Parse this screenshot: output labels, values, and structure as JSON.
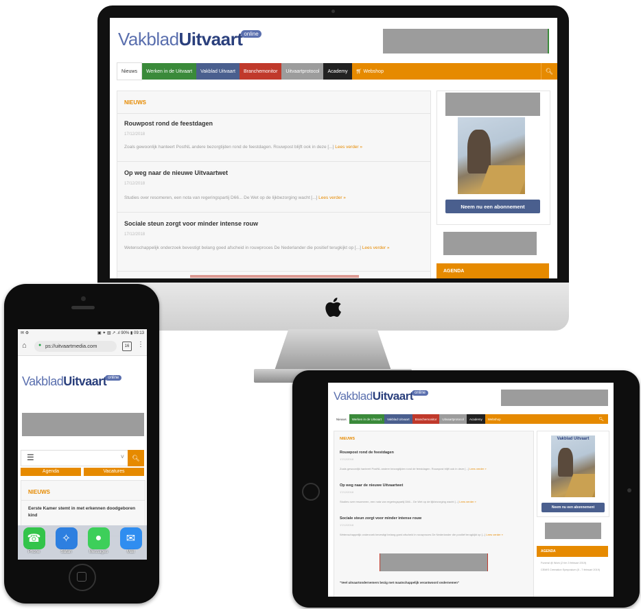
{
  "site": {
    "logo_light": "Vakblad",
    "logo_bold": "Uitvaart",
    "logo_badge": "online"
  },
  "nav": {
    "items": [
      "Nieuws",
      "Werken in de Uitvaart",
      "Vakblad Uitvaart",
      "Branchemonitor",
      "Uitvaartprotocol",
      "Academy",
      "Webshop"
    ],
    "colors": [
      "#ffffff",
      "#3a8a3a",
      "#4a5f8e",
      "#c0392b",
      "#9c9c9c",
      "#222222",
      "#e68a00"
    ]
  },
  "news": {
    "section_title": "NIEUWS",
    "posts": [
      {
        "title": "Rouwpost rond de feestdagen",
        "date": "17/12/2018",
        "excerpt": "Zoals gewoonlijk hanteert PostNL andere bezorgtijden rond de feestdagen. Rouwpost blijft ook in deze [...]",
        "more": "Lees verder »"
      },
      {
        "title": "Op weg naar de nieuwe Uitvaartwet",
        "date": "17/12/2018",
        "excerpt": "Studies over resomeren, een nota van regeringspartij D66... De Wet op de lijkbezorging wacht [...]",
        "more": "Lees verder »"
      },
      {
        "title": "Sociale steun zorgt voor minder intense rouw",
        "date": "17/12/2018",
        "excerpt": "Wetenschappelijk onderzoek bevestigt belang goed afscheid in rouwproces De Nederlander die positief terugkijkt op [...]",
        "more": "Lees verder »"
      }
    ],
    "extra_post_title": "\"Veel uitvaartondernemers bezig met maatschappelijk verantwoord ondernemen\""
  },
  "sidebar": {
    "subscribe_button": "Neem nu een abonnement",
    "agenda_title": "AGENDA",
    "ipad_cover_title": "Vakblad Uitvaart",
    "agenda_items": [
      "Funeral @ Work (2 t/m 3 februari 2019)",
      "CEMIS Cremation Symposium (5 - 7 februari 2019)"
    ]
  },
  "phone": {
    "status_left": "✉ ⚙",
    "status_right": "▣ ✦ ▧ ↗ .ıl 90% ▮ 09:13",
    "url": "ps://uitvaartmedia.com",
    "tab_count": "16",
    "menu_icon": "hamburger-icon",
    "chevron": "˅",
    "subnav": [
      "Agenda",
      "Vacatures"
    ],
    "section_title": "NIEUWS",
    "post_title": "Eerste Kamer stemt in met erkennen doodgeboren kind",
    "dock": [
      {
        "label": "Phone",
        "icon": "phone-icon",
        "color": "#33c44a",
        "glyph": "☎"
      },
      {
        "label": "Safari",
        "icon": "safari-icon",
        "color": "#2d7fe0",
        "glyph": "✧"
      },
      {
        "label": "Messages",
        "icon": "messages-icon",
        "color": "#3dcf5a",
        "glyph": "●"
      },
      {
        "label": "Mail",
        "icon": "mail-icon",
        "color": "#2f8df0",
        "glyph": "✉"
      }
    ]
  },
  "colors": {
    "accent": "#e68a00",
    "brand": "#2a3f7c",
    "button": "#4a5f8e"
  }
}
